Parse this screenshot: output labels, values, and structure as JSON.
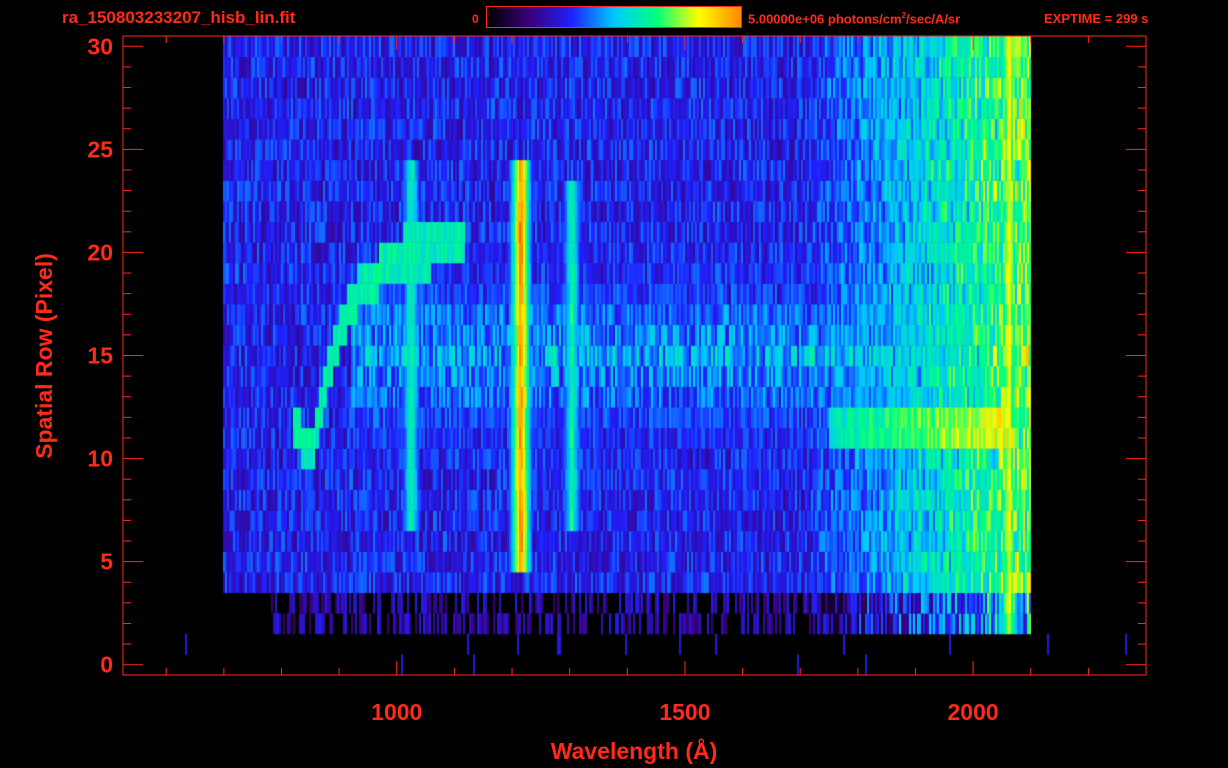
{
  "header": {
    "file_title": "ra_150803233207_hisb_lin.fit",
    "colorbar_min": "0",
    "colorbar_max_pre": "5.00000e+06 photons/cm",
    "colorbar_max_sup": "2",
    "colorbar_max_post": "/sec/A/sr",
    "exptime": "EXPTIME = 299 s"
  },
  "colors": {
    "axis": "#ff2a1a",
    "background": "#000000",
    "colormap": [
      "#000000",
      "#3a007a",
      "#2020ff",
      "#00c8ff",
      "#00ff80",
      "#ffff00",
      "#ff8800",
      "#ff2000"
    ]
  },
  "chart_data": {
    "type": "heatmap",
    "title": "ra_150803233207_hisb_lin.fit",
    "xlabel": "Wavelength (Å)",
    "ylabel": "Spatial Row (Pixel)",
    "xlim": [
      525,
      2300
    ],
    "ylim": [
      -0.5,
      30.5
    ],
    "x_ticks": [
      1000,
      1500,
      2000
    ],
    "y_ticks": [
      0,
      5,
      10,
      15,
      20,
      25,
      30
    ],
    "colorbar": {
      "min": 0,
      "max": 5000000,
      "units": "photons/cm^2/sec/A/sr"
    },
    "grid": false,
    "coverage": {
      "x_start": 700,
      "x_end": 2100,
      "rows_full": [
        4,
        30
      ]
    },
    "features": [
      {
        "name": "emission-line",
        "x": 1215,
        "rows": [
          5,
          24
        ],
        "intensity": 0.95
      },
      {
        "name": "emission-line",
        "x": 1304,
        "rows": [
          7,
          23
        ],
        "intensity": 0.6
      },
      {
        "name": "emission-line",
        "x": 1025,
        "rows": [
          7,
          24
        ],
        "intensity": 0.6
      },
      {
        "name": "emission-line",
        "x": 2062,
        "rows": [
          2,
          30
        ],
        "intensity": 0.8
      },
      {
        "name": "bright-band",
        "x": [
          1750,
          2060
        ],
        "rows": [
          11,
          12
        ],
        "intensity": 0.75
      },
      {
        "name": "diffuse-band",
        "x": [
          920,
          2060
        ],
        "rows": [
          7,
          23
        ],
        "intensity": 0.45
      },
      {
        "name": "curved-trace",
        "points": [
          [
            820,
            12
          ],
          [
            850,
            10
          ],
          [
            880,
            14
          ],
          [
            900,
            16
          ],
          [
            930,
            18
          ],
          [
            970,
            19
          ],
          [
            1010,
            20
          ],
          [
            1060,
            20
          ],
          [
            1120,
            21
          ]
        ],
        "intensity": 0.55
      }
    ]
  }
}
